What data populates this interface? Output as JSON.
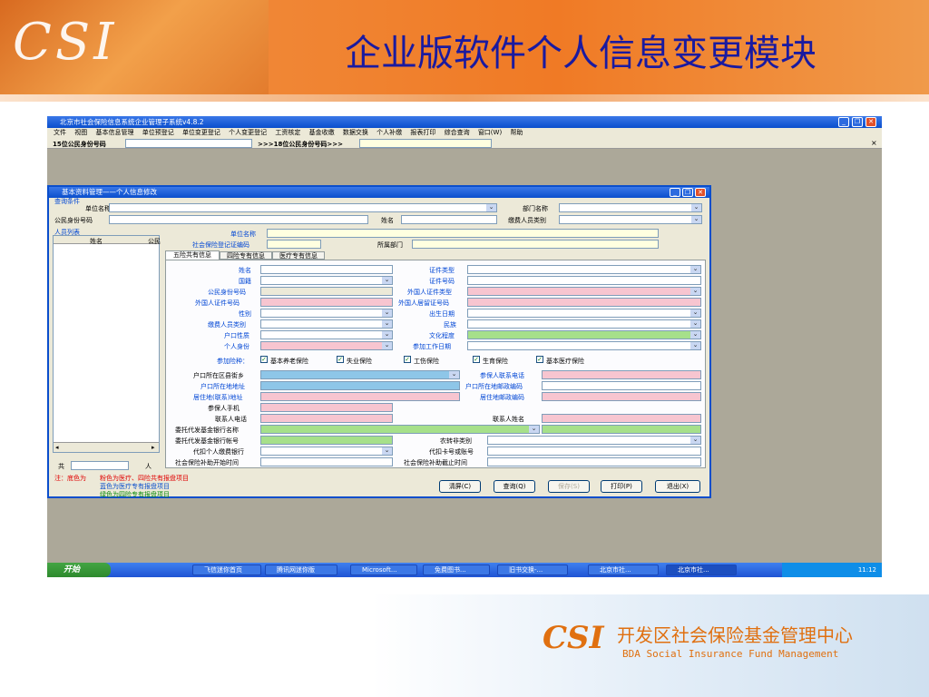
{
  "slide": {
    "title": "企业版软件个人信息变更模块",
    "logo_text": "CSI",
    "footer_cn": "开发区社会保险基金管理中心",
    "footer_en": "BDA Social Insurance Fund Management"
  },
  "colors": {
    "accent_orange": "#f07a25",
    "title_blue": "#1a1aa0",
    "window_blue": "#0a4ecc"
  },
  "window": {
    "title": "北京市社会保险信息系统企业管理子系统v4.8.2",
    "menu": [
      "文件",
      "视图",
      "基本信息管理",
      "单位预登记",
      "单位变更登记",
      "个人变更登记",
      "工资核定",
      "基金收缴",
      "数据交换",
      "个人补缴",
      "报表打印",
      "综合查询",
      "窗口(W)",
      "帮助"
    ],
    "id_label": "15位公民身份号码",
    "id18_label": ">>>18位公民身份号码>>>"
  },
  "dialog": {
    "title": "基本资料管理——个人信息修改",
    "query_group": "查询条件",
    "unit_name": "单位名称",
    "dept_name": "部门名称",
    "citizen_id": "公民身份号码",
    "name": "姓名",
    "pay_type": "缴费人员类别",
    "person_list": "人员列表",
    "col_name": "姓名",
    "col_id": "公民",
    "total_label": "共",
    "person_unit": "人",
    "unit_name2": "单位名称",
    "social_reg_no": "社会保险登记证编码",
    "dept": "所属部门",
    "tabs": [
      "五险共有信息",
      "四险专有信息",
      "医疗专有信息"
    ],
    "f_name": "姓名",
    "f_cert_type": "证件类型",
    "f_nationality": "国籍",
    "f_cert_no": "证件号码",
    "f_citizen_id": "公民身份号码",
    "f_foreign_cert_type": "外国人证件类型",
    "f_foreign_cert_no": "外国人证件号码",
    "f_foreign_res_no": "外国人居留证号码",
    "f_gender": "性别",
    "f_birth": "出生日期",
    "f_pay_type": "缴费人员类别",
    "f_ethnic": "民族",
    "f_hukou": "户口性质",
    "f_education": "文化程度",
    "f_identity": "个人身份",
    "f_work_date": "参加工作日期",
    "insurance_label": "参加险种：",
    "insurances": [
      "基本养老保险",
      "失业保险",
      "工伤保险",
      "生育保险",
      "基本医疗保险"
    ],
    "f_district": "户口所在区县街乡",
    "f_contact": "参保人联系电话",
    "f_hukou_addr": "户口所在地地址",
    "f_hukou_zip": "户口所在地邮政编码",
    "f_res_addr": "居住地(联系)地址",
    "f_res_zip": "居住地邮政编码",
    "f_mobile": "参保人手机",
    "f_contact_phone": "联系人电话",
    "f_contact_name": "联系人姓名",
    "f_bank_name": "委托代发基金银行名称",
    "f_bank_acct": "委托代发基金银行帐号",
    "f_farmer_type": "农转非类别",
    "f_personal_bank": "代扣个人缴费银行",
    "f_card_no": "代扣卡号或账号",
    "f_subsidy_start": "社会保险补助开始时间",
    "f_subsidy_end": "社会保险补助截止时间",
    "notes": [
      "注：底色为",
      "粉色为医疗、四险共有报盘项目",
      "蓝色为医疗专有报盘项目",
      "绿色为四险专有报盘项目"
    ],
    "buttons": [
      "清屏(C)",
      "查询(Q)",
      "保存(S)",
      "打印(P)",
      "退出(X)"
    ]
  },
  "taskbar": {
    "start": "开始",
    "items": [
      "飞信迷你首页",
      "腾讯网迷你版",
      "Microsoft...",
      "免费图书...",
      "旧书交换-...",
      "北京市社...",
      "北京市社..."
    ],
    "clock": "11:12"
  }
}
